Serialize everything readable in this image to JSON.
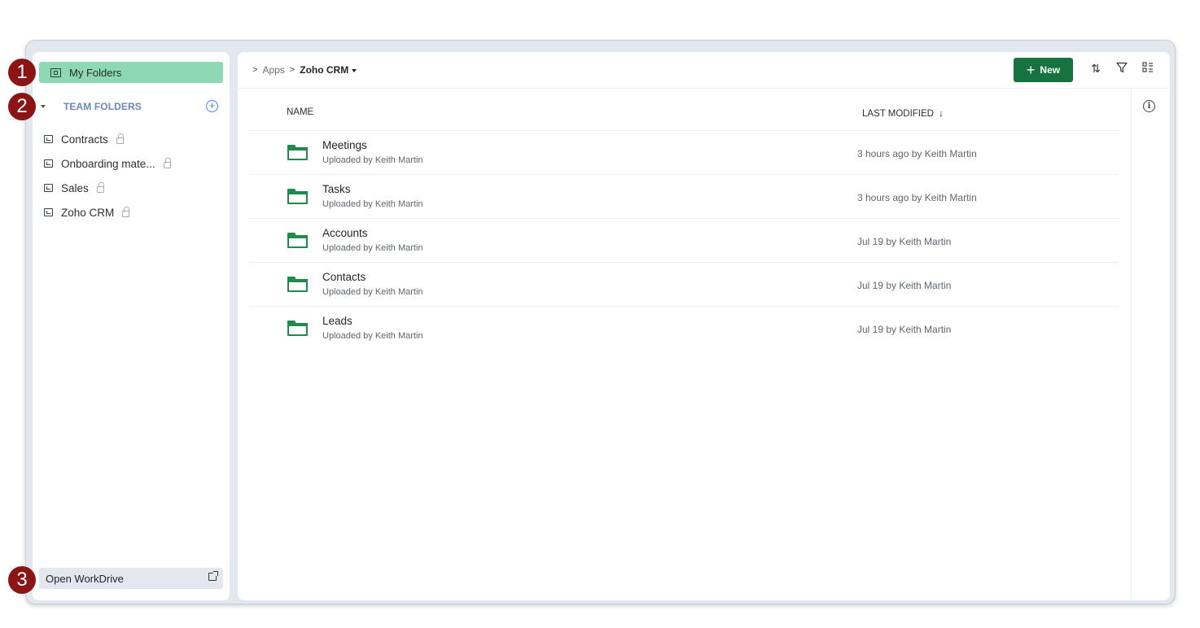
{
  "sidebar": {
    "my_folders": "My Folders",
    "team_header": "TEAM FOLDERS",
    "team_items": [
      {
        "label": "Contracts"
      },
      {
        "label": "Onboarding mate..."
      },
      {
        "label": "Sales"
      },
      {
        "label": "Zoho CRM"
      }
    ],
    "open_workdrive": "Open WorkDrive"
  },
  "breadcrumb": {
    "items": [
      "Apps"
    ],
    "current": "Zoho CRM"
  },
  "toolbar": {
    "new_label": "New",
    "sort_icon": "sort-icon",
    "filter_icon": "filter-icon",
    "view_icon": "list-view-icon"
  },
  "table": {
    "col_name": "NAME",
    "col_modified": "LAST MODIFIED",
    "rows": [
      {
        "name": "Meetings",
        "sub": "Uploaded by Keith Martin",
        "modified": "3 hours ago by Keith Martin"
      },
      {
        "name": "Tasks",
        "sub": "Uploaded by Keith Martin",
        "modified": "3 hours ago by Keith Martin"
      },
      {
        "name": "Accounts",
        "sub": "Uploaded by Keith Martin",
        "modified": "Jul 19 by Keith Martin"
      },
      {
        "name": "Contacts",
        "sub": "Uploaded by Keith Martin",
        "modified": "Jul 19 by Keith Martin"
      },
      {
        "name": "Leads",
        "sub": "Uploaded by Keith Martin",
        "modified": "Jul 19 by Keith Martin"
      }
    ]
  },
  "badges": [
    "1",
    "2",
    "3"
  ],
  "colors": {
    "accent_green": "#16733f",
    "selected_bg": "#8fd8b6",
    "badge_red": "#8b1414",
    "team_header": "#6b89b8"
  }
}
